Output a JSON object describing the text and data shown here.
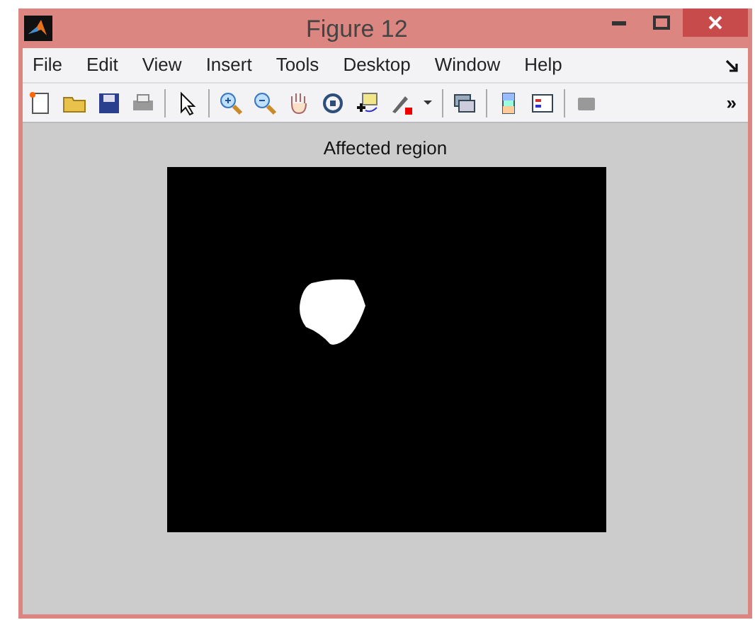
{
  "window": {
    "title": "Figure 12"
  },
  "menu": [
    "File",
    "Edit",
    "View",
    "Insert",
    "Tools",
    "Desktop",
    "Window",
    "Help"
  ],
  "toolbar": {
    "overflow": "»"
  },
  "axes": {
    "title": "Affected region"
  }
}
